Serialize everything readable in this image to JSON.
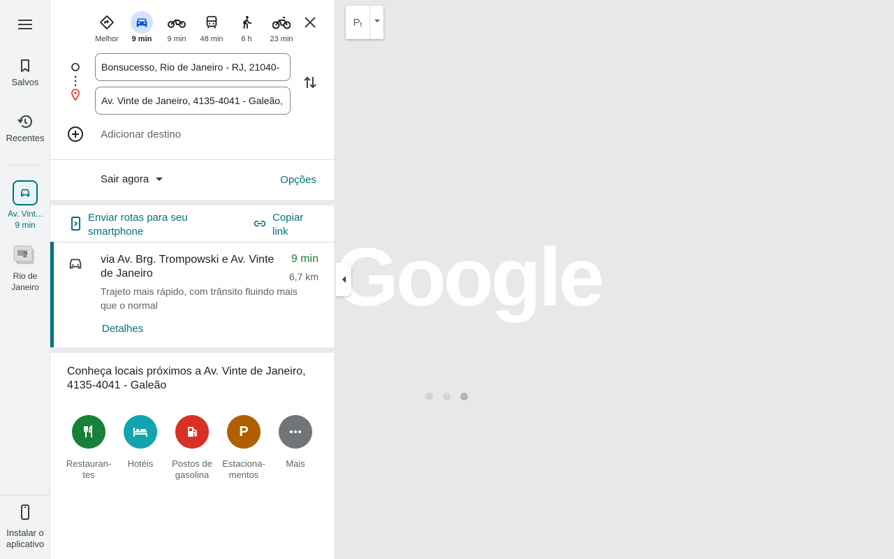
{
  "rail": {
    "saved_label": "Salvos",
    "recents_label": "Recentes",
    "recent_route_label": "Av. Vint...",
    "recent_route_time": "9 min",
    "recent_place_badge": "2",
    "recent_place_label_1": "Rio de",
    "recent_place_label_2": "Janeiro",
    "install_label_1": "Instalar o",
    "install_label_2": "aplicativo"
  },
  "modes": [
    {
      "name": "best",
      "label": "Melhor"
    },
    {
      "name": "car",
      "label": "9 min",
      "active": true
    },
    {
      "name": "motorcycle",
      "label": "9 min"
    },
    {
      "name": "transit",
      "label": "48 min"
    },
    {
      "name": "walk",
      "label": "6 h"
    },
    {
      "name": "bike",
      "label": "23 min"
    }
  ],
  "directions": {
    "origin": "Bonsucesso, Rio de Janeiro - RJ, 21040-",
    "destination": "Av. Vinte de Janeiro, 4135-4041 - Galeão,",
    "add_destination": "Adicionar destino"
  },
  "depart": {
    "label": "Sair agora",
    "options": "Opções"
  },
  "share": {
    "send_label": "Enviar rotas para seu smartphone",
    "copy_label": "Copiar link"
  },
  "route": {
    "title": "via Av. Brg. Trompowski e Av. Vinte de Janeiro",
    "time": "9 min",
    "distance": "6,7 km",
    "description": "Trajeto mais rápido, com trânsito fluindo mais que o normal",
    "details": "Detalhes"
  },
  "nearby": {
    "title": "Conheça locais próximos a Av. Vinte de Janeiro, 4135-4041 - Galeão",
    "categories": [
      {
        "label": "Restauran-tes",
        "color": "#188038",
        "icon": "restaurant-icon"
      },
      {
        "label": "Hotéis",
        "color": "#12a4af",
        "icon": "hotel-icon"
      },
      {
        "label": "Postos de gasolina",
        "color": "#d93025",
        "icon": "gas-station-icon"
      },
      {
        "label": "Estaciona-mentos",
        "color": "#b06000",
        "icon": "parking-icon",
        "glyph": "P"
      },
      {
        "label": "Mais",
        "color": "#70757a",
        "icon": "more-icon"
      }
    ]
  },
  "map": {
    "layer_button_label": "P",
    "watermark": "Google",
    "loading_dot_colors": [
      "#d7d3cf",
      "#d7d3cf",
      "#b9b5b1"
    ]
  },
  "colors": {
    "accent": "#00727d",
    "route_time": "#188038"
  }
}
